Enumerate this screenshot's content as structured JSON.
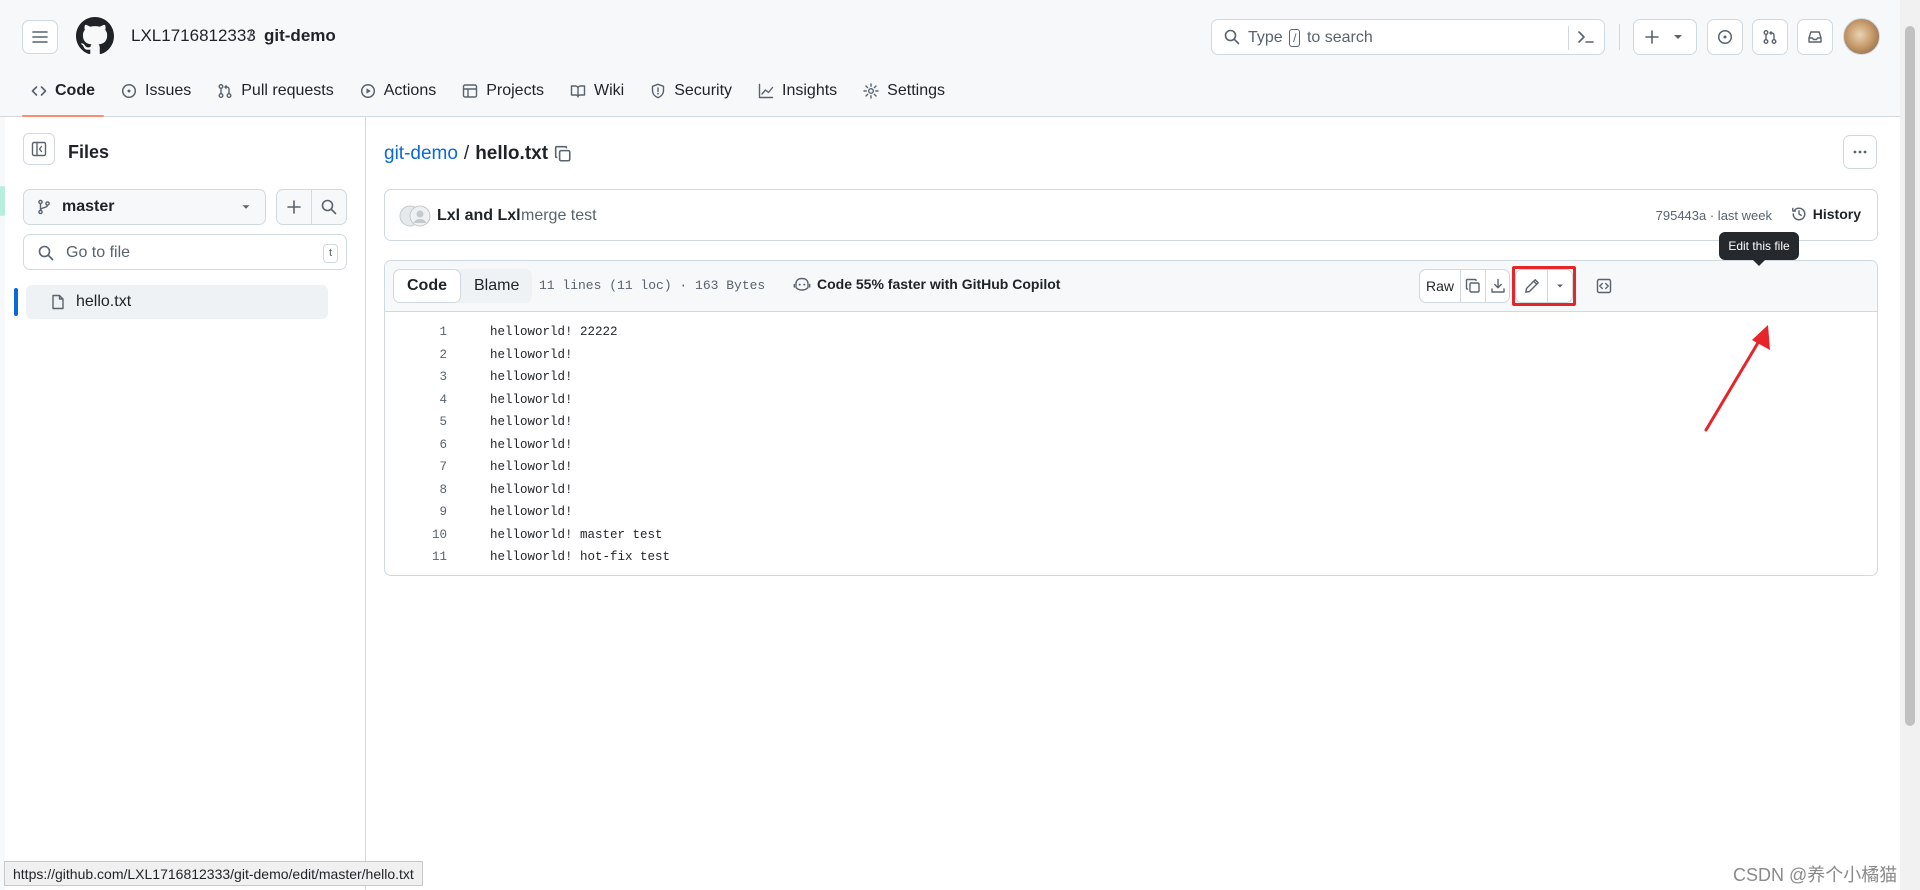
{
  "header": {
    "owner": "LXL1716812333",
    "separator": "/",
    "repo": "git-demo",
    "search": {
      "prefix": "Type",
      "key": "/",
      "suffix": "to search"
    }
  },
  "repo_nav": [
    {
      "label": "Code",
      "icon": "code-icon",
      "active": true
    },
    {
      "label": "Issues",
      "icon": "issue-icon"
    },
    {
      "label": "Pull requests",
      "icon": "pull-request-icon"
    },
    {
      "label": "Actions",
      "icon": "play-icon"
    },
    {
      "label": "Projects",
      "icon": "table-icon"
    },
    {
      "label": "Wiki",
      "icon": "book-icon"
    },
    {
      "label": "Security",
      "icon": "shield-icon"
    },
    {
      "label": "Insights",
      "icon": "graph-icon"
    },
    {
      "label": "Settings",
      "icon": "gear-icon"
    }
  ],
  "sidebar": {
    "title": "Files",
    "branch": "master",
    "goto_placeholder": "Go to file",
    "goto_key": "t",
    "files": [
      {
        "name": "hello.txt",
        "selected": true
      }
    ]
  },
  "breadcrumb": {
    "repo": "git-demo",
    "separator": "/",
    "file": "hello.txt"
  },
  "commit": {
    "authors": "Lxl and Lxl",
    "message": "merge test",
    "sha_time": "795443a · last week",
    "history_label": "History"
  },
  "file": {
    "tabs": [
      "Code",
      "Blame"
    ],
    "active_tab": "Code",
    "meta": "11 lines (11 loc) · 163 Bytes",
    "copilot": "Code 55% faster with GitHub Copilot",
    "raw_label": "Raw",
    "tooltip": "Edit this file",
    "lines": [
      "helloworld! 22222",
      "helloworld!",
      "helloworld!",
      "helloworld!",
      "helloworld!",
      "helloworld!",
      "helloworld!",
      "helloworld!",
      "helloworld!",
      "helloworld! master test",
      "helloworld! hot-fix test"
    ]
  },
  "status_bar": {
    "url": "https://github.com/LXL1716812333/git-demo/edit/master/hello.txt"
  },
  "watermark": "CSDN @养个小橘猫",
  "colors": {
    "accent": "#0969da",
    "tab_underline": "#fd8c73",
    "highlight_box": "#e5252a",
    "tooltip_bg": "#25292e"
  }
}
